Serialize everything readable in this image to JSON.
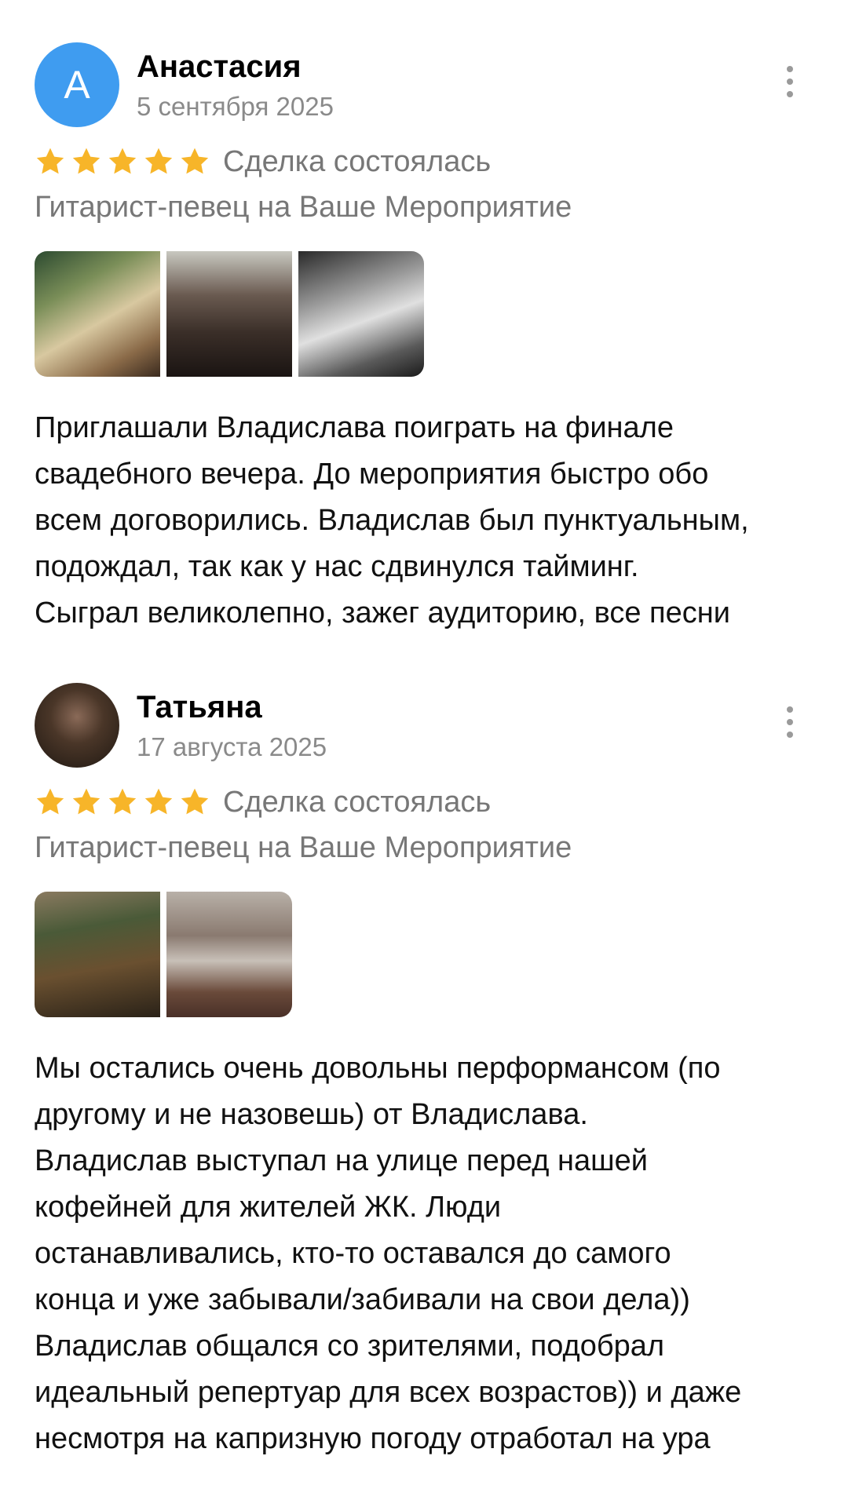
{
  "reviews": [
    {
      "avatar_letter": "А",
      "author": "Анастасия",
      "date": "5 сентября 2025",
      "rating": 5,
      "status": "Сделка состоялась",
      "service": "Гитарист-певец на Ваше Мероприятие",
      "photo_count": 3,
      "text_lines": [
        "Приглашали Владислава поиграть на финале",
        "свадебного вечера. До мероприятия быстро обо",
        "всем договорились. Владислав был пунктуальным,",
        "подождал, так как у нас сдвинулся тайминг.",
        "Сыграл великолепно, зажег аудиторию, все песни"
      ]
    },
    {
      "author": "Татьяна",
      "date": "17 августа 2025",
      "rating": 5,
      "status": "Сделка состоялась",
      "service": "Гитарист-певец на Ваше Мероприятие",
      "photo_count": 2,
      "text_lines": [
        "Мы остались очень довольны перформансом (по",
        "другому и не назовешь) от Владислава.",
        "Владислав выступал на улице перед нашей",
        "кофейней для жителей ЖК. Люди",
        "останавливались, кто-то оставался до самого",
        "конца и уже забывали/забивали на свои дела))",
        "Владислав общался со зрителями, подобрал",
        "идеальный репертуар для всех возрастов)) и даже",
        "несмотря на капризную погоду отработал на ура"
      ]
    }
  ],
  "colors": {
    "star": "#f7b529",
    "avatar_bg": "#3f9cf0",
    "muted_text": "#777777"
  },
  "icons": {
    "star": "star-icon",
    "menu": "more-vertical-icon"
  }
}
